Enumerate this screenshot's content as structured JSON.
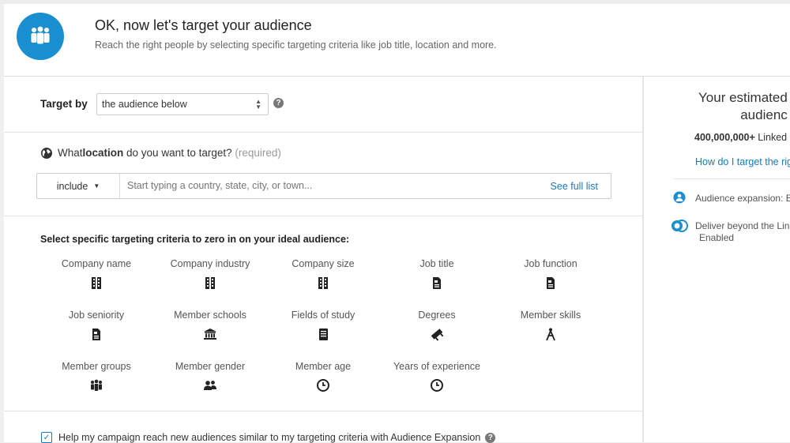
{
  "header": {
    "title": "OK, now let's target your audience",
    "subtitle": "Reach the right people by selecting specific targeting criteria like job title, location and more.",
    "icon": "audience-group-icon"
  },
  "target_by": {
    "label": "Target by",
    "selected": "the audience below"
  },
  "location": {
    "question_prefix": "What ",
    "question_bold": "location",
    "question_suffix": " do you want to target? ",
    "required": "(required)",
    "include_label": "include",
    "placeholder": "Start typing a country, state, city, or town...",
    "see_full_list": "See full list"
  },
  "criteria": {
    "heading": "Select specific targeting criteria to zero in on your ideal audience:",
    "items": [
      {
        "label": "Company name",
        "icon": "building-icon"
      },
      {
        "label": "Company industry",
        "icon": "building-icon"
      },
      {
        "label": "Company size",
        "icon": "building-icon"
      },
      {
        "label": "Job title",
        "icon": "document-icon"
      },
      {
        "label": "Job function",
        "icon": "document-icon"
      },
      {
        "label": "Job seniority",
        "icon": "document-icon"
      },
      {
        "label": "Member schools",
        "icon": "institution-icon"
      },
      {
        "label": "Fields of study",
        "icon": "book-icon"
      },
      {
        "label": "Degrees",
        "icon": "diploma-icon"
      },
      {
        "label": "Member skills",
        "icon": "compass-icon"
      },
      {
        "label": "Member groups",
        "icon": "group-icon"
      },
      {
        "label": "Member gender",
        "icon": "people-icon"
      },
      {
        "label": "Member age",
        "icon": "clock-icon"
      },
      {
        "label": "Years of experience",
        "icon": "clock-icon"
      }
    ]
  },
  "expansion_checkbox": {
    "label": "Help my campaign reach new audiences similar to my targeting criteria with Audience Expansion",
    "checked": true
  },
  "estimate": {
    "title_line1": "Your estimated",
    "title_line2": "audienc",
    "count_bold": "400,000,000+",
    "count_rest": " Linked",
    "link": "How do I target the righ",
    "expansion": "Audience expansion: E",
    "deliver_line1": "Deliver beyond the Lin",
    "deliver_line2": "Enabled"
  },
  "colors": {
    "accent": "#1a8fcf",
    "link": "#1a78b8"
  }
}
